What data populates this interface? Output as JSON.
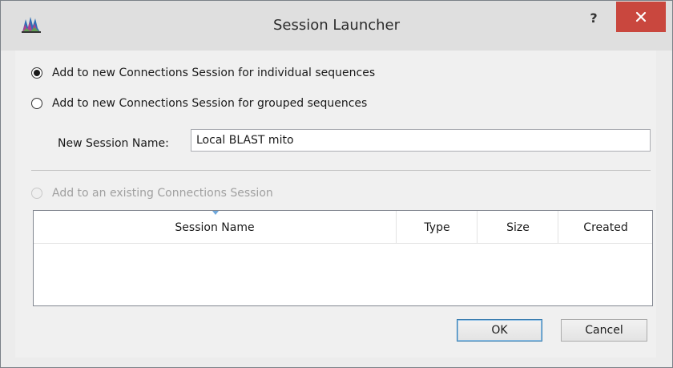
{
  "window": {
    "title": "Session Launcher",
    "help_label": "?",
    "close_label": "×"
  },
  "options": {
    "individual_label": "Add to new Connections Session for individual sequences",
    "individual_selected": true,
    "grouped_label": "Add to new Connections Session for grouped sequences",
    "grouped_selected": false,
    "existing_label": "Add to an existing Connections Session",
    "existing_enabled": false
  },
  "session_name": {
    "label": "New Session Name:",
    "value": "Local BLAST mito"
  },
  "table": {
    "columns": [
      "Session Name",
      "Type",
      "Size",
      "Created"
    ],
    "sorted_column": "Session Name",
    "rows": []
  },
  "buttons": {
    "ok": "OK",
    "cancel": "Cancel"
  }
}
